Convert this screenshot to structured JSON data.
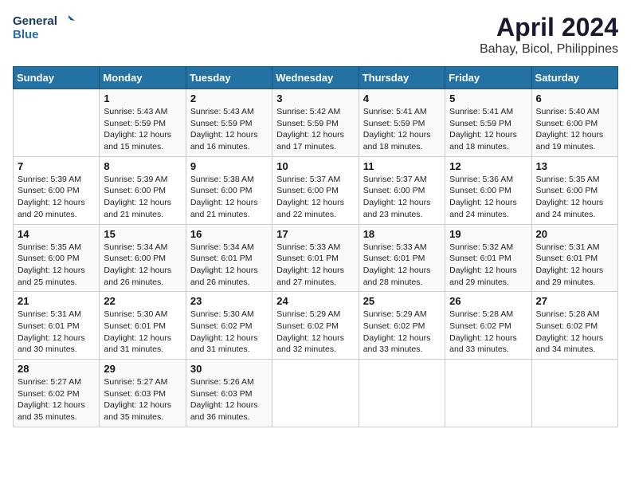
{
  "header": {
    "logo_line1": "General",
    "logo_line2": "Blue",
    "month_title": "April 2024",
    "location": "Bahay, Bicol, Philippines"
  },
  "columns": [
    "Sunday",
    "Monday",
    "Tuesday",
    "Wednesday",
    "Thursday",
    "Friday",
    "Saturday"
  ],
  "weeks": [
    [
      {
        "day": "",
        "sunrise": "",
        "sunset": "",
        "daylight": ""
      },
      {
        "day": "1",
        "sunrise": "Sunrise: 5:43 AM",
        "sunset": "Sunset: 5:59 PM",
        "daylight": "Daylight: 12 hours and 15 minutes."
      },
      {
        "day": "2",
        "sunrise": "Sunrise: 5:43 AM",
        "sunset": "Sunset: 5:59 PM",
        "daylight": "Daylight: 12 hours and 16 minutes."
      },
      {
        "day": "3",
        "sunrise": "Sunrise: 5:42 AM",
        "sunset": "Sunset: 5:59 PM",
        "daylight": "Daylight: 12 hours and 17 minutes."
      },
      {
        "day": "4",
        "sunrise": "Sunrise: 5:41 AM",
        "sunset": "Sunset: 5:59 PM",
        "daylight": "Daylight: 12 hours and 18 minutes."
      },
      {
        "day": "5",
        "sunrise": "Sunrise: 5:41 AM",
        "sunset": "Sunset: 5:59 PM",
        "daylight": "Daylight: 12 hours and 18 minutes."
      },
      {
        "day": "6",
        "sunrise": "Sunrise: 5:40 AM",
        "sunset": "Sunset: 6:00 PM",
        "daylight": "Daylight: 12 hours and 19 minutes."
      }
    ],
    [
      {
        "day": "7",
        "sunrise": "Sunrise: 5:39 AM",
        "sunset": "Sunset: 6:00 PM",
        "daylight": "Daylight: 12 hours and 20 minutes."
      },
      {
        "day": "8",
        "sunrise": "Sunrise: 5:39 AM",
        "sunset": "Sunset: 6:00 PM",
        "daylight": "Daylight: 12 hours and 21 minutes."
      },
      {
        "day": "9",
        "sunrise": "Sunrise: 5:38 AM",
        "sunset": "Sunset: 6:00 PM",
        "daylight": "Daylight: 12 hours and 21 minutes."
      },
      {
        "day": "10",
        "sunrise": "Sunrise: 5:37 AM",
        "sunset": "Sunset: 6:00 PM",
        "daylight": "Daylight: 12 hours and 22 minutes."
      },
      {
        "day": "11",
        "sunrise": "Sunrise: 5:37 AM",
        "sunset": "Sunset: 6:00 PM",
        "daylight": "Daylight: 12 hours and 23 minutes."
      },
      {
        "day": "12",
        "sunrise": "Sunrise: 5:36 AM",
        "sunset": "Sunset: 6:00 PM",
        "daylight": "Daylight: 12 hours and 24 minutes."
      },
      {
        "day": "13",
        "sunrise": "Sunrise: 5:35 AM",
        "sunset": "Sunset: 6:00 PM",
        "daylight": "Daylight: 12 hours and 24 minutes."
      }
    ],
    [
      {
        "day": "14",
        "sunrise": "Sunrise: 5:35 AM",
        "sunset": "Sunset: 6:00 PM",
        "daylight": "Daylight: 12 hours and 25 minutes."
      },
      {
        "day": "15",
        "sunrise": "Sunrise: 5:34 AM",
        "sunset": "Sunset: 6:00 PM",
        "daylight": "Daylight: 12 hours and 26 minutes."
      },
      {
        "day": "16",
        "sunrise": "Sunrise: 5:34 AM",
        "sunset": "Sunset: 6:01 PM",
        "daylight": "Daylight: 12 hours and 26 minutes."
      },
      {
        "day": "17",
        "sunrise": "Sunrise: 5:33 AM",
        "sunset": "Sunset: 6:01 PM",
        "daylight": "Daylight: 12 hours and 27 minutes."
      },
      {
        "day": "18",
        "sunrise": "Sunrise: 5:33 AM",
        "sunset": "Sunset: 6:01 PM",
        "daylight": "Daylight: 12 hours and 28 minutes."
      },
      {
        "day": "19",
        "sunrise": "Sunrise: 5:32 AM",
        "sunset": "Sunset: 6:01 PM",
        "daylight": "Daylight: 12 hours and 29 minutes."
      },
      {
        "day": "20",
        "sunrise": "Sunrise: 5:31 AM",
        "sunset": "Sunset: 6:01 PM",
        "daylight": "Daylight: 12 hours and 29 minutes."
      }
    ],
    [
      {
        "day": "21",
        "sunrise": "Sunrise: 5:31 AM",
        "sunset": "Sunset: 6:01 PM",
        "daylight": "Daylight: 12 hours and 30 minutes."
      },
      {
        "day": "22",
        "sunrise": "Sunrise: 5:30 AM",
        "sunset": "Sunset: 6:01 PM",
        "daylight": "Daylight: 12 hours and 31 minutes."
      },
      {
        "day": "23",
        "sunrise": "Sunrise: 5:30 AM",
        "sunset": "Sunset: 6:02 PM",
        "daylight": "Daylight: 12 hours and 31 minutes."
      },
      {
        "day": "24",
        "sunrise": "Sunrise: 5:29 AM",
        "sunset": "Sunset: 6:02 PM",
        "daylight": "Daylight: 12 hours and 32 minutes."
      },
      {
        "day": "25",
        "sunrise": "Sunrise: 5:29 AM",
        "sunset": "Sunset: 6:02 PM",
        "daylight": "Daylight: 12 hours and 33 minutes."
      },
      {
        "day": "26",
        "sunrise": "Sunrise: 5:28 AM",
        "sunset": "Sunset: 6:02 PM",
        "daylight": "Daylight: 12 hours and 33 minutes."
      },
      {
        "day": "27",
        "sunrise": "Sunrise: 5:28 AM",
        "sunset": "Sunset: 6:02 PM",
        "daylight": "Daylight: 12 hours and 34 minutes."
      }
    ],
    [
      {
        "day": "28",
        "sunrise": "Sunrise: 5:27 AM",
        "sunset": "Sunset: 6:02 PM",
        "daylight": "Daylight: 12 hours and 35 minutes."
      },
      {
        "day": "29",
        "sunrise": "Sunrise: 5:27 AM",
        "sunset": "Sunset: 6:03 PM",
        "daylight": "Daylight: 12 hours and 35 minutes."
      },
      {
        "day": "30",
        "sunrise": "Sunrise: 5:26 AM",
        "sunset": "Sunset: 6:03 PM",
        "daylight": "Daylight: 12 hours and 36 minutes."
      },
      {
        "day": "",
        "sunrise": "",
        "sunset": "",
        "daylight": ""
      },
      {
        "day": "",
        "sunrise": "",
        "sunset": "",
        "daylight": ""
      },
      {
        "day": "",
        "sunrise": "",
        "sunset": "",
        "daylight": ""
      },
      {
        "day": "",
        "sunrise": "",
        "sunset": "",
        "daylight": ""
      }
    ]
  ]
}
